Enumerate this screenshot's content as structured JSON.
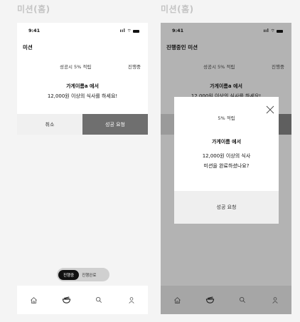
{
  "frames": [
    {
      "heading": "미션(홈)",
      "status_time": "9:41",
      "status_icons": "ııl ⌔",
      "page_title": "미션",
      "reward": "성공시 5% 적립",
      "status": "진행중",
      "store": "가게이름a 에서",
      "mission": "12,000원 이상의 식사를 하세요!",
      "cancel": "취소",
      "success": "성공 요청",
      "toggle_on": "진행중",
      "toggle_off": "진행완료"
    },
    {
      "heading": "미션(홈)",
      "status_time": "9:41",
      "status_icons": "ııl ⌔",
      "page_title": "진행중인 미션",
      "reward": "성공시 5% 적립",
      "status": "진행중",
      "store": "가게이름a 에서",
      "mission": "12,000원 이상의 식사를 하세요!",
      "modal": {
        "reward": "5% 적립",
        "store": "가게이름 에서",
        "line1": "12,000원 이상의 식사",
        "line2": "미션을 완료하셨나요?",
        "button": "성공 요청"
      }
    }
  ],
  "icons": [
    "home-icon",
    "bowl-icon",
    "search-icon",
    "user-icon"
  ]
}
